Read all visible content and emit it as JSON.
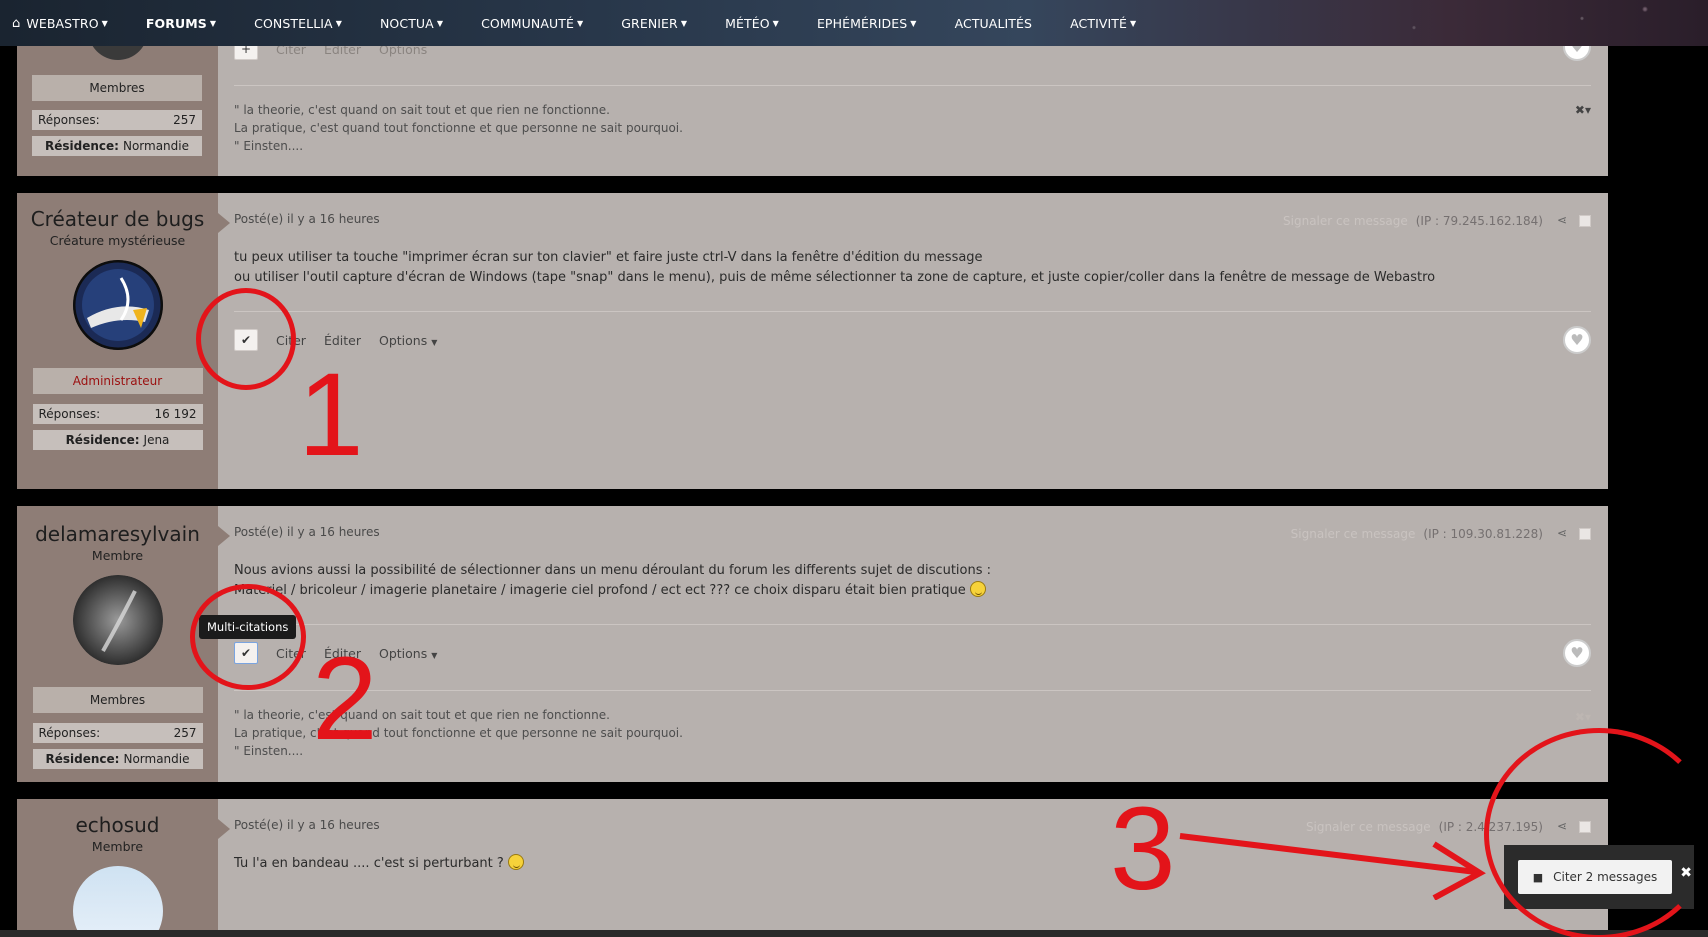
{
  "nav": {
    "items": [
      {
        "label": "WEBASTRO"
      },
      {
        "label": "FORUMS"
      },
      {
        "label": "CONSTELLIA"
      },
      {
        "label": "NOCTUA"
      },
      {
        "label": "COMMUNAUTÉ"
      },
      {
        "label": "GRENIER"
      },
      {
        "label": "MÉTÉO"
      },
      {
        "label": "EPHÉMÉRIDES"
      },
      {
        "label": "ACTUALITÉS"
      },
      {
        "label": "ACTIVITÉ"
      }
    ]
  },
  "post0": {
    "actions": {
      "quote": "Citer",
      "edit": "Éditer",
      "options": "Options"
    },
    "role": "Membres",
    "replies_label": "Réponses:",
    "replies": "257",
    "residence_label": "Résidence:",
    "residence": "Normandie",
    "signature": [
      "\" la theorie, c'est quand on sait tout et que rien ne fonctionne.",
      "La pratique, c'est quand tout fonctionne et que personne ne sait pourquoi.",
      "\" Einsten...."
    ]
  },
  "post1": {
    "username": "Créateur de bugs",
    "title": "Créature mystérieuse",
    "role": "Administrateur",
    "replies_label": "Réponses:",
    "replies": "16 192",
    "residence_label": "Résidence:",
    "residence": "Jena",
    "posted": "Posté(e) il y a 16 heures",
    "report": "Signaler ce message",
    "ip": "(IP : 79.245.162.184)",
    "body": [
      "tu peux utiliser ta touche \"imprimer écran sur ton clavier\" et faire juste ctrl-V dans la fenêtre d'édition du message",
      "ou utiliser l'outil capture d'écran de Windows (tape \"snap\" dans le menu), puis de même sélectionner ta zone de capture, et juste copier/coller dans la fenêtre de message de Webastro"
    ],
    "actions": {
      "quote": "Citer",
      "edit": "Éditer",
      "options": "Options"
    }
  },
  "post2": {
    "username": "delamaresylvain",
    "title": "Membre",
    "role": "Membres",
    "replies_label": "Réponses:",
    "replies": "257",
    "residence_label": "Résidence:",
    "residence": "Normandie",
    "posted": "Posté(e) il y a 16 heures",
    "report": "Signaler ce message",
    "ip": "(IP : 109.30.81.228)",
    "body": [
      "Nous avions aussi la possibilité de sélectionner dans un menu déroulant du forum les differents sujet de discutions :",
      "Materiel / bricoleur / imagerie planetaire / imagerie ciel profond /  ect ect ??? ce choix disparu était bien pratique"
    ],
    "actions": {
      "quote": "Citer",
      "edit": "Éditer",
      "options": "Options"
    },
    "signature": [
      "\" la theorie, c'est quand on sait tout et que rien ne fonctionne.",
      "La pratique, c'est quand tout fonctionne et que personne ne sait pourquoi.",
      "\" Einsten...."
    ]
  },
  "post3": {
    "username": "echosud",
    "title": "Membre",
    "posted": "Posté(e) il y a 16 heures",
    "report": "Signaler ce message",
    "ip": "(IP : 2.4.237.195)",
    "body": "Tu l'a en bandeau .... c'est si perturbant ?"
  },
  "tooltip": "Multi-citations",
  "annotations": [
    "1",
    "2",
    "3"
  ],
  "multiquote": {
    "button": "Citer 2 messages"
  },
  "colors": {
    "annotation": "#e3141a",
    "admin": "#9b1010",
    "post_bg": "#b7b1ae",
    "author_bg": "#8e7d76"
  }
}
